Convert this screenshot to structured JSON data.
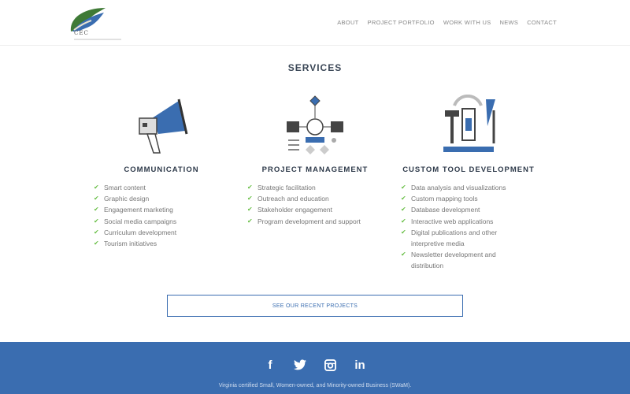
{
  "header": {
    "logo_text": "CEC",
    "nav": [
      "ABOUT",
      "PROJECT PORTFOLIO",
      "WORK WITH US",
      "NEWS",
      "CONTACT"
    ]
  },
  "services": {
    "title": "SERVICES",
    "columns": [
      {
        "icon": "megaphone-icon",
        "heading": "COMMUNICATION",
        "items": [
          "Smart content",
          "Graphic design",
          "Engagement marketing",
          "Social media campaigns",
          "Curriculum development",
          "Tourism initiatives"
        ]
      },
      {
        "icon": "flowchart-icon",
        "heading": "PROJECT MANAGEMENT",
        "items": [
          "Strategic facilitation",
          "Outreach and education",
          "Stakeholder engagement",
          "Program development and support"
        ]
      },
      {
        "icon": "tools-icon",
        "heading": "CUSTOM TOOL DEVELOPMENT",
        "items": [
          "Data analysis and visualizations",
          "Custom mapping tools",
          "Database development",
          "Interactive web applications",
          "Digital publications and other interpretive media",
          "Newsletter development and distribution"
        ]
      }
    ]
  },
  "cta": {
    "label": "SEE OUR RECENT PROJECTS"
  },
  "footer": {
    "social": [
      "facebook-icon",
      "twitter-icon",
      "instagram-icon",
      "linkedin-icon"
    ],
    "text": "Virginia certified Small, Women-owned, and Minority-owned Business (SWaM)."
  },
  "colors": {
    "brand": "#3a6db0",
    "check": "#6cc04a",
    "heading": "#2e3a4a"
  }
}
